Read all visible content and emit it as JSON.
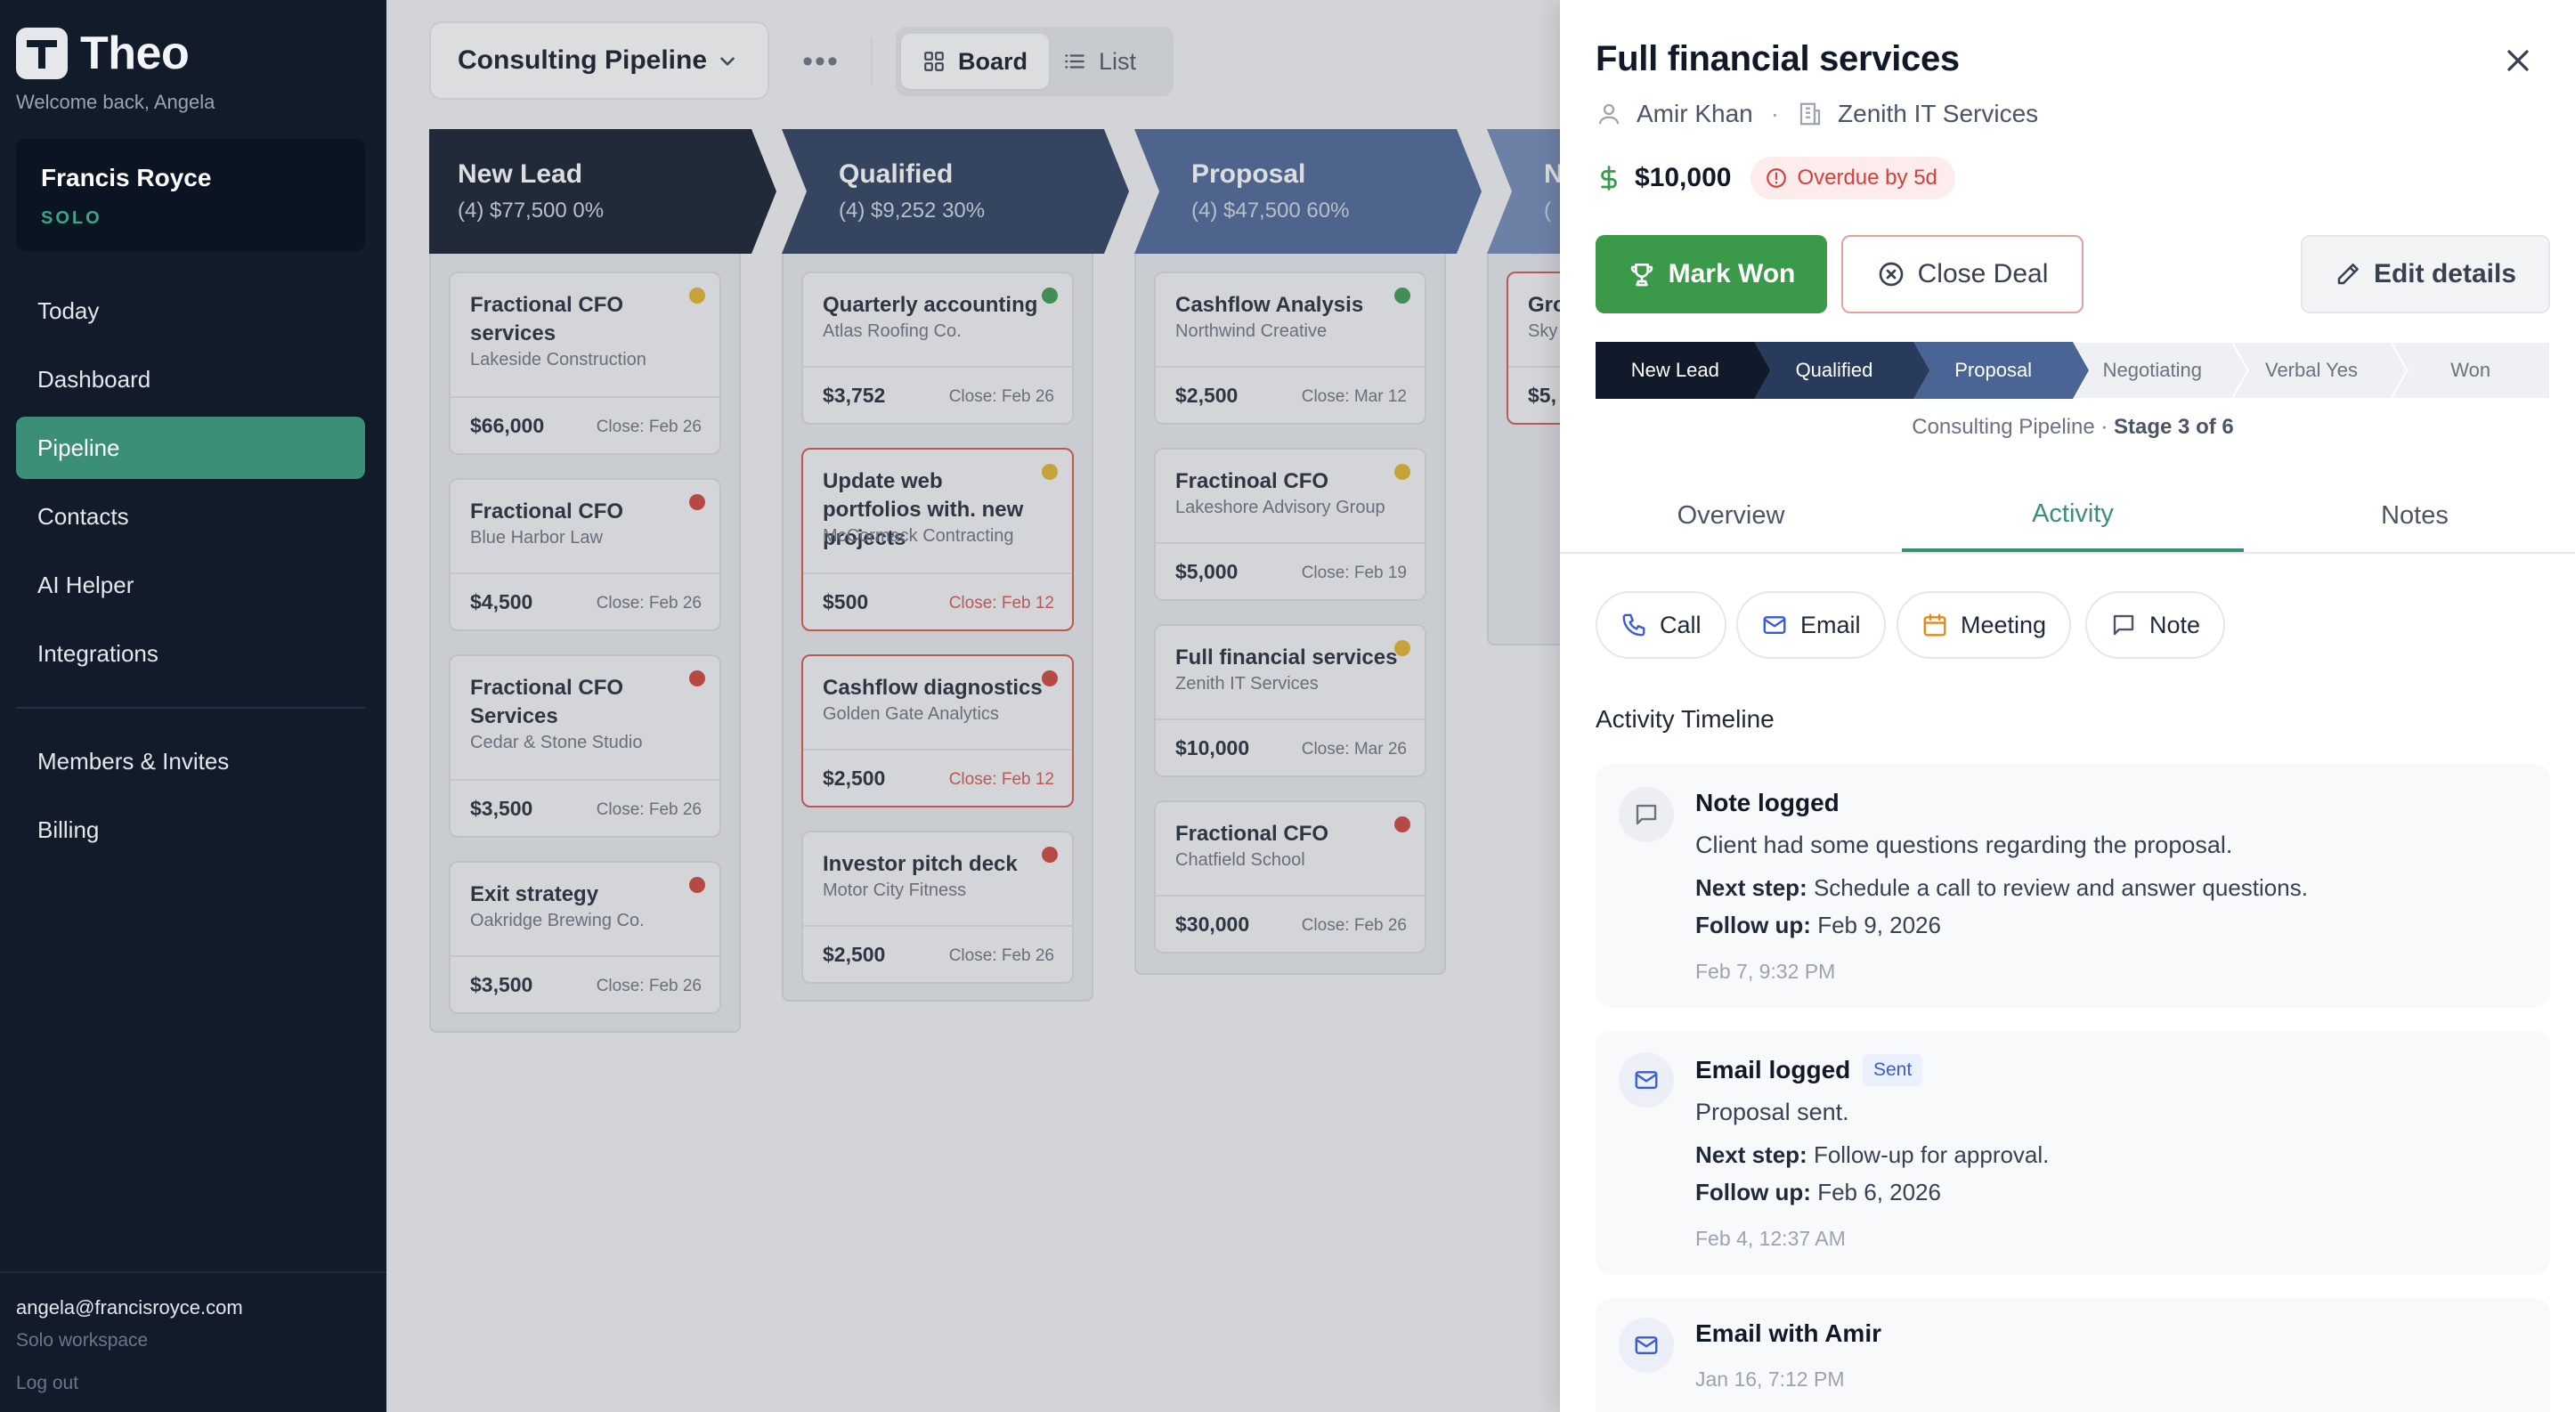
{
  "app": {
    "name": "Theo",
    "welcome": "Welcome back, Angela"
  },
  "workspace": {
    "name": "Francis Royce",
    "plan": "SOLO"
  },
  "nav": {
    "items": [
      "Today",
      "Dashboard",
      "Pipeline",
      "Contacts",
      "AI Helper",
      "Integrations"
    ],
    "secondary": [
      "Members & Invites",
      "Billing"
    ],
    "active": "Pipeline"
  },
  "account": {
    "email": "angela@francisroyce.com",
    "workspace": "Solo workspace",
    "logout": "Log out"
  },
  "toolbar": {
    "pipeline": "Consulting Pipeline",
    "more": "•••",
    "board": "Board",
    "list": "List",
    "active_view": "Board"
  },
  "stages": [
    {
      "name": "New Lead",
      "summary": "(4) $77,500  0%",
      "color": "#101a2b"
    },
    {
      "name": "Qualified",
      "summary": "(4) $9,252  30%",
      "color": "#293b5c"
    },
    {
      "name": "Proposal",
      "summary": "(4) $47,500  60%",
      "color": "#4a6595"
    },
    {
      "name": "N",
      "summary": "(",
      "color": "#7189b6"
    }
  ],
  "columns": [
    [
      {
        "title": "Fractional CFO services",
        "company": "Lakeside Construction",
        "amount": "$66,000",
        "close": "Close: Feb 26",
        "dot": "#e2b52a",
        "overdue": false
      },
      {
        "title": "Fractional CFO",
        "company": "Blue Harbor Law",
        "amount": "$4,500",
        "close": "Close: Feb 26",
        "dot": "#cf4238",
        "overdue": false
      },
      {
        "title": "Fractional CFO Services",
        "company": "Cedar & Stone Studio",
        "amount": "$3,500",
        "close": "Close: Feb 26",
        "dot": "#cf4238",
        "overdue": false
      },
      {
        "title": "Exit strategy",
        "company": "Oakridge Brewing Co.",
        "amount": "$3,500",
        "close": "Close: Feb 26",
        "dot": "#cf4238",
        "overdue": false
      }
    ],
    [
      {
        "title": "Quarterly accounting",
        "company": "Atlas Roofing Co.",
        "amount": "$3,752",
        "close": "Close: Feb 26",
        "dot": "#3c9a4e",
        "overdue": false
      },
      {
        "title": "Update web portfolios with. new projects",
        "company": "McCormack Contracting",
        "amount": "$500",
        "close": "Close: Feb 12",
        "dot": "#e2b52a",
        "overdue": true
      },
      {
        "title": "Cashflow diagnostics",
        "company": "Golden Gate Analytics",
        "amount": "$2,500",
        "close": "Close: Feb 12",
        "dot": "#cf4238",
        "overdue": true
      },
      {
        "title": "Investor pitch deck",
        "company": "Motor City Fitness",
        "amount": "$2,500",
        "close": "Close: Feb 26",
        "dot": "#cf4238",
        "overdue": false
      }
    ],
    [
      {
        "title": "Cashflow Analysis",
        "company": "Northwind Creative",
        "amount": "$2,500",
        "close": "Close: Mar 12",
        "dot": "#3c9a4e",
        "overdue": false
      },
      {
        "title": "Fractinoal CFO",
        "company": "Lakeshore Advisory Group",
        "amount": "$5,000",
        "close": "Close: Feb 19",
        "dot": "#e2b52a",
        "overdue": false
      },
      {
        "title": "Full financial services",
        "company": "Zenith IT Services",
        "amount": "$10,000",
        "close": "Close: Mar 26",
        "dot": "#e2b52a",
        "overdue": false
      },
      {
        "title": "Fractional CFO",
        "company": "Chatfield School",
        "amount": "$30,000",
        "close": "Close: Feb 26",
        "dot": "#cf4238",
        "overdue": false
      }
    ],
    [
      {
        "title": "Gro",
        "company": "Sky",
        "amount": "$5,",
        "close": "",
        "dot": "",
        "overdue": true
      }
    ]
  ],
  "panel": {
    "title": "Full financial services",
    "contact": "Amir Khan",
    "company": "Zenith IT Services",
    "amount": "$10,000",
    "overdue": "Overdue by 5d",
    "actions": {
      "won": "Mark Won",
      "close": "Close Deal",
      "edit": "Edit details"
    },
    "progress": {
      "stages": [
        "New Lead",
        "Qualified",
        "Proposal",
        "Negotiating",
        "Verbal Yes",
        "Won"
      ],
      "current_index": 2,
      "caption_prefix": "Consulting Pipeline · ",
      "caption_stage": "Stage 3 of 6"
    },
    "tabs": [
      "Overview",
      "Activity",
      "Notes"
    ],
    "active_tab": "Activity",
    "log_buttons": [
      "Call",
      "Email",
      "Meeting",
      "Note"
    ],
    "timeline_title": "Activity Timeline",
    "timeline": [
      {
        "icon": "message-icon",
        "title": "Note logged",
        "text": "Client had some questions regarding the proposal.",
        "next_label": "Next step:",
        "next": "Schedule a call to review and answer questions.",
        "follow_label": "Follow up:",
        "follow": "Feb 9, 2026",
        "time": "Feb 7, 9:32 PM"
      },
      {
        "icon": "mail-icon",
        "title": "Email logged",
        "badge": "Sent",
        "text": "Proposal sent.",
        "next_label": "Next step:",
        "next": "Follow-up for approval.",
        "follow_label": "Follow up:",
        "follow": "Feb 6, 2026",
        "time": "Feb 4, 12:37 AM"
      },
      {
        "icon": "mail-icon",
        "title": "Email with Amir",
        "time": "Jan 16, 7:12 PM"
      }
    ]
  },
  "colors": {
    "accent": "#3c8f77",
    "won": "#3a9a4a",
    "danger": "#d4403a",
    "sidebar": "#111b2a"
  }
}
